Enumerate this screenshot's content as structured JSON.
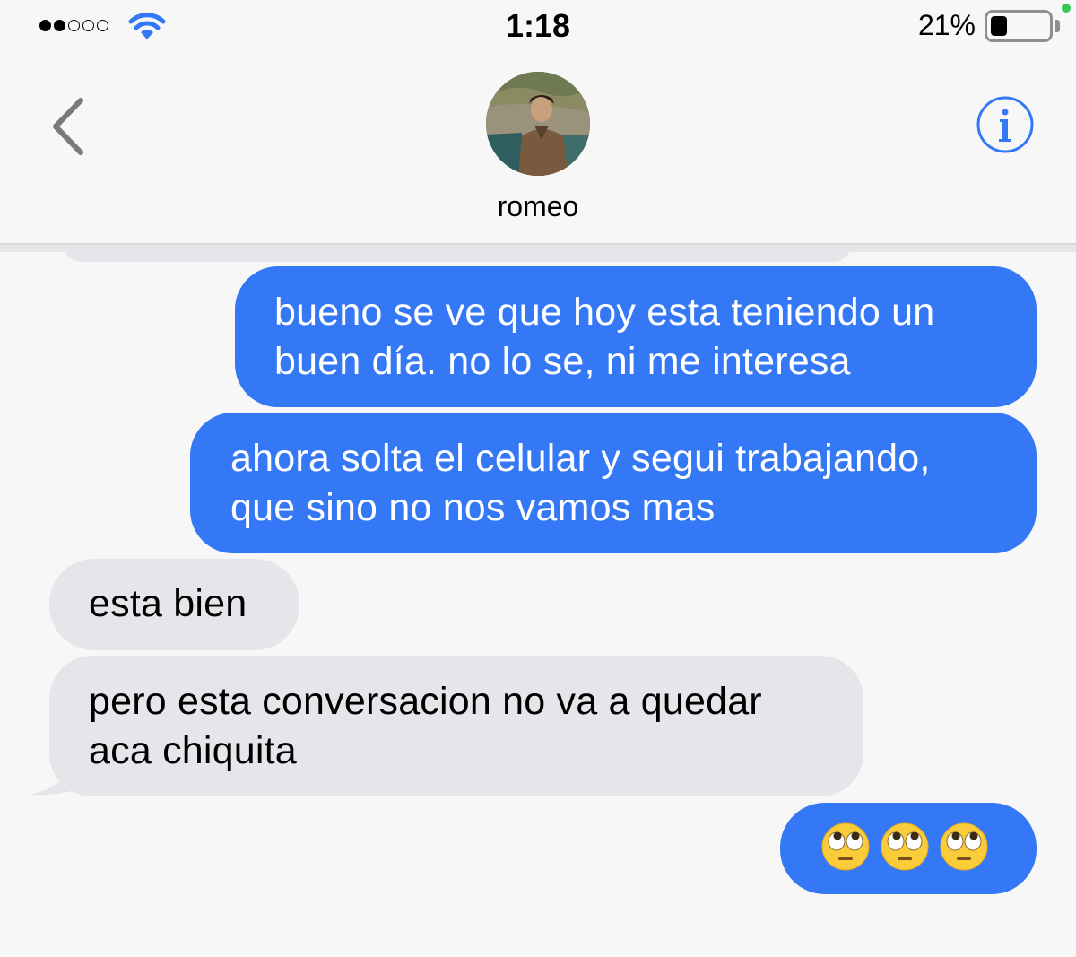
{
  "status_bar": {
    "time": "1:18",
    "battery_percent": "21%",
    "battery_level": 0.21,
    "signal_bars_filled": 2,
    "signal_bars_total": 5
  },
  "header": {
    "contact_name": "romeo",
    "back_icon": "chevron-left-icon",
    "info_icon": "info-icon"
  },
  "colors": {
    "sent_bubble": "#3478f6",
    "received_bubble": "#e5e5ea",
    "accent": "#3478f6"
  },
  "messages": [
    {
      "direction": "sent",
      "lines": [
        "bueno se ve que hoy esta teniendo un",
        "buen día. no lo se, ni me interesa"
      ]
    },
    {
      "direction": "sent",
      "lines": [
        "ahora solta el celular y segui trabajando,",
        "que sino no nos vamos mas"
      ]
    },
    {
      "direction": "received",
      "lines": [
        "esta bien"
      ]
    },
    {
      "direction": "received",
      "lines": [
        "pero esta conversacion no va a quedar",
        "aca chiquita"
      ]
    },
    {
      "direction": "sent",
      "emoji": [
        "face-with-rolling-eyes",
        "face-with-rolling-eyes",
        "face-with-rolling-eyes"
      ]
    }
  ]
}
